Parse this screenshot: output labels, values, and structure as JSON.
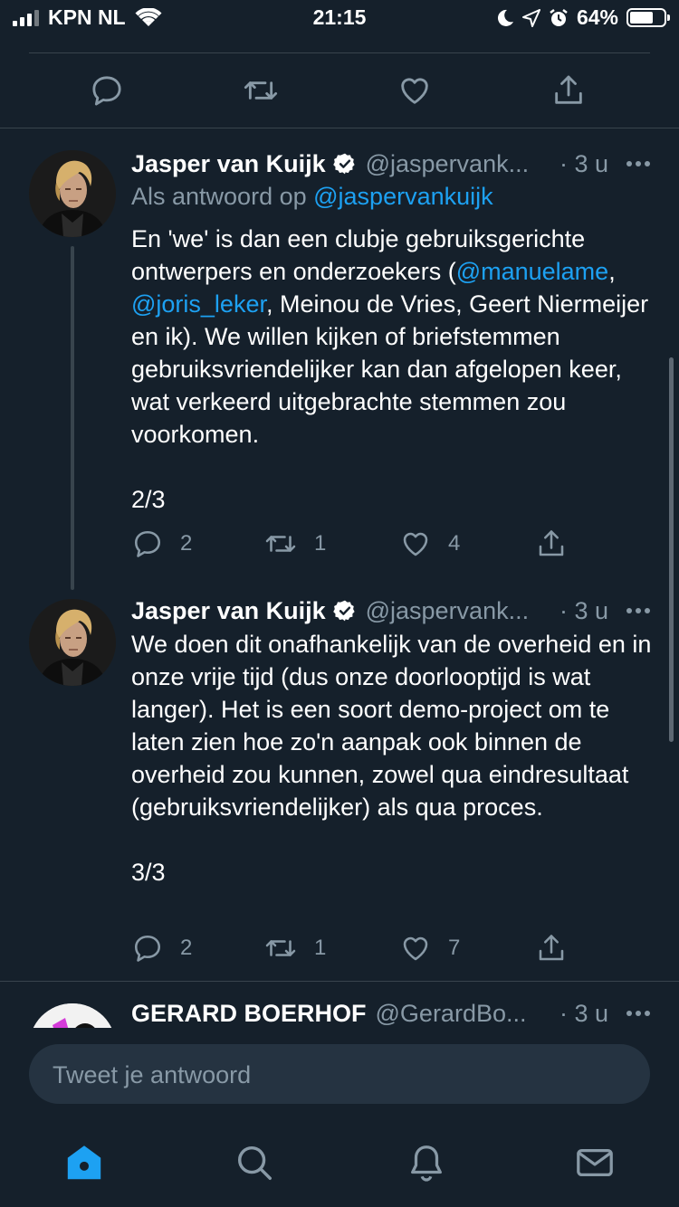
{
  "status_bar": {
    "carrier": "KPN NL",
    "time": "21:15",
    "battery": "64%"
  },
  "tweets": [
    {
      "name": "Jasper van Kuijk",
      "handle": "@jaspervank...",
      "time": "· 3 u",
      "reply_prefix": "Als antwoord op ",
      "reply_handle": "@jaspervankuijk",
      "text_1": "En 'we' is dan een clubje gebruiksgerichte ontwerpers en onderzoekers (",
      "mention_1": "@manuelame",
      "text_2": ",\n",
      "mention_2": "@joris_leker",
      "text_3": ", Meinou de Vries, Geert Niermeijer en ik). We willen kijken of briefstemmen gebruiksvriendelijker kan dan afgelopen keer, wat verkeerd uitgebrachte stemmen zou voorkomen.\n\n2/3",
      "replies": "2",
      "retweets": "1",
      "likes": "4"
    },
    {
      "name": "Jasper van Kuijk",
      "handle": "@jaspervank...",
      "time": "· 3 u",
      "text": "We doen dit onafhankelijk van de overheid en in onze vrije tijd (dus onze doorlooptijd is wat langer). Het is een soort demo-project om te laten zien hoe zo'n aanpak ook binnen de overheid zou kunnen, zowel qua eindresultaat (gebruiksvriendelijker) als qua proces.\n\n3/3",
      "replies": "2",
      "retweets": "1",
      "likes": "7"
    },
    {
      "name": "GERARD BOERHOF",
      "handle": "@GerardBo...",
      "time": "· 3 u"
    }
  ],
  "reply_bar": {
    "placeholder": "Tweet je antwoord"
  },
  "tab_bar": {
    "items": [
      "home-icon",
      "search-icon",
      "notifications-icon",
      "messages-icon"
    ],
    "active_color": "#1da1f2"
  },
  "colors": {
    "background": "#15202b",
    "secondary_text": "#8899a6",
    "link": "#1da1f2",
    "separator": "#38444d"
  }
}
